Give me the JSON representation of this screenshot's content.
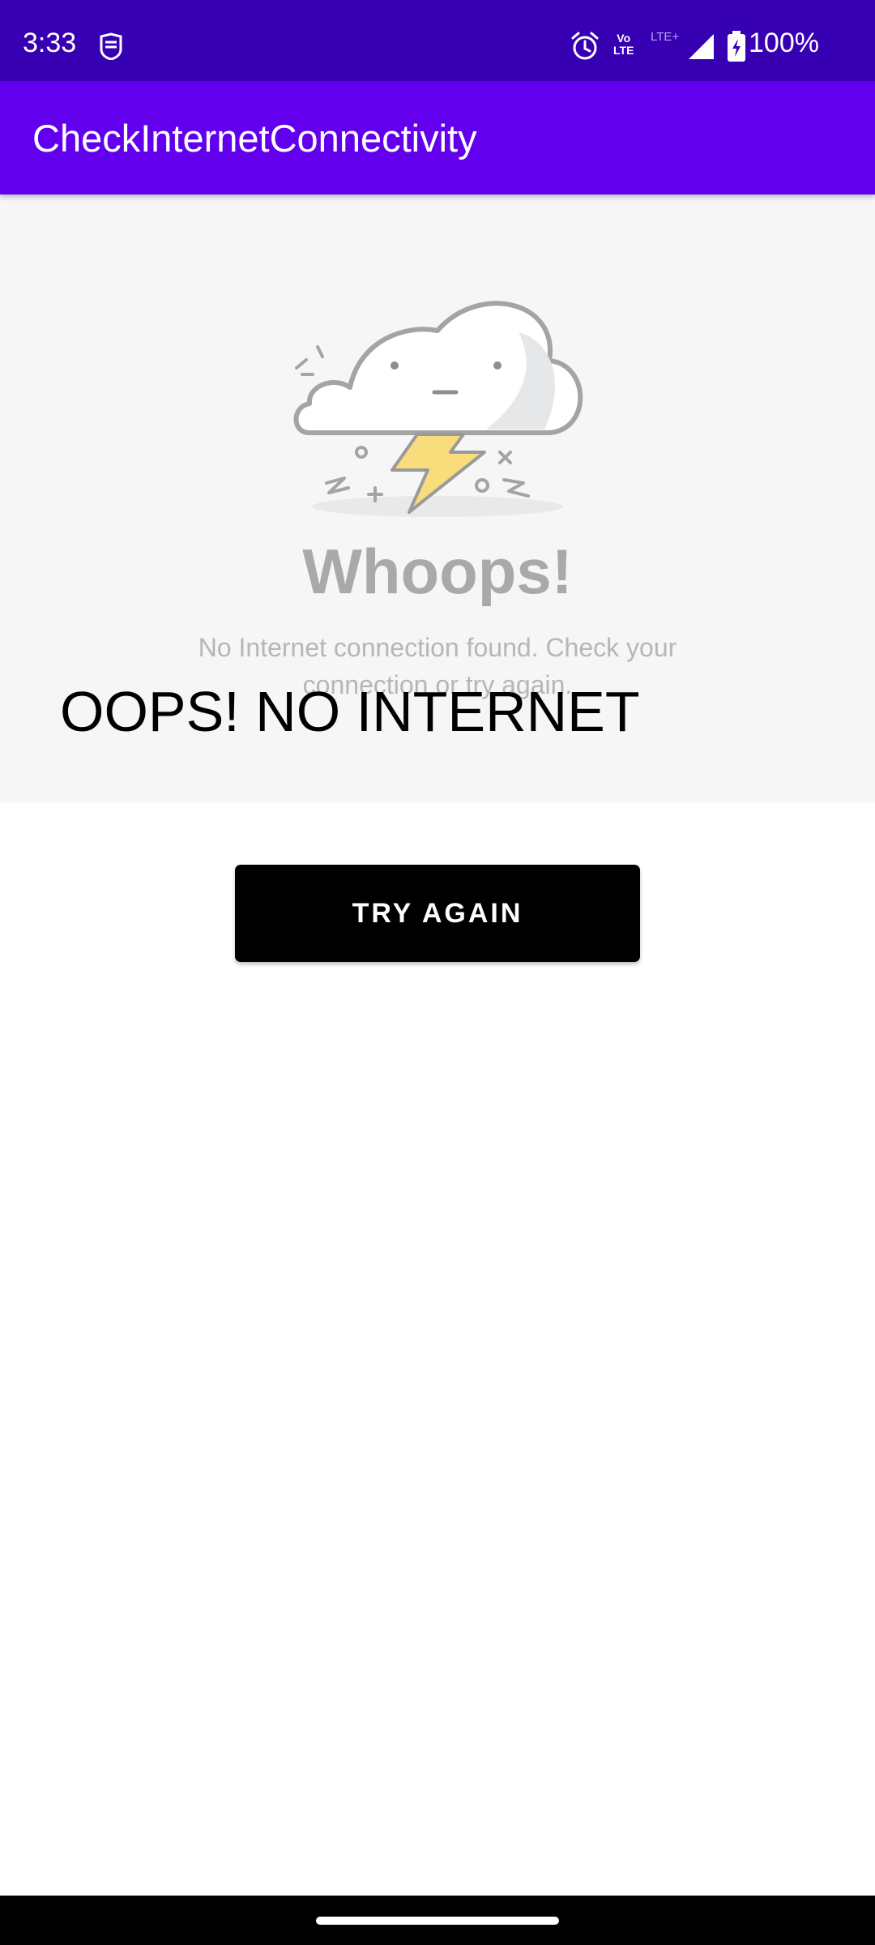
{
  "status_bar": {
    "time": "3:33",
    "battery": "100%",
    "volte_line1": "Vo",
    "volte_line2": "LTE",
    "lte_plus": "LTE+",
    "icons": [
      "shield-icon",
      "alarm-icon",
      "volte-icon",
      "signal-icon",
      "battery-icon"
    ]
  },
  "app_bar": {
    "title": "CheckInternetConnectivity"
  },
  "illustration": {
    "heading": "Whoops!",
    "message": "No Internet connection found. Check your connection or try again."
  },
  "main": {
    "error_text": "OOPS! NO INTERNET",
    "button_label": "TRY AGAIN"
  },
  "colors": {
    "status_bar": "#3700b3",
    "app_bar": "#6200ee",
    "hero_background": "#f6f6f6",
    "button": "#000000",
    "bolt": "#f9dd7c"
  }
}
